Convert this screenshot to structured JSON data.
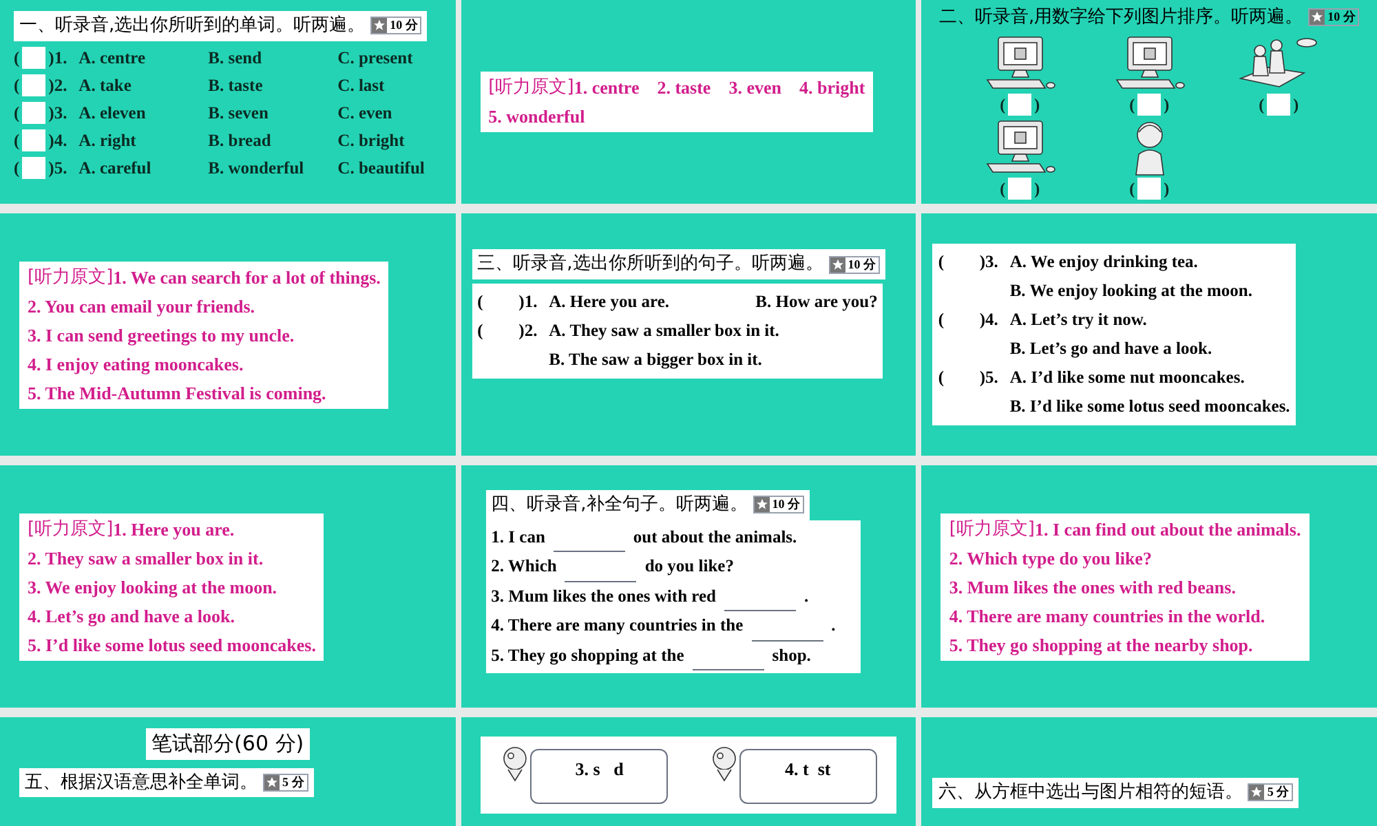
{
  "rows": [
    {
      "slides": [
        {
          "kind": "choice_words",
          "heading": {
            "text": "一、听录音,选出你所听到的单词。听两遍。",
            "score": "10 分"
          },
          "items": [
            {
              "open": "(",
              "close": ")1.",
              "options": [
                "A. centre",
                "B. send",
                "C. present"
              ]
            },
            {
              "open": "(",
              "close": ")2.",
              "options": [
                "A. take",
                "B. taste",
                "C. last"
              ]
            },
            {
              "open": "(",
              "close": ")3.",
              "options": [
                "A. eleven",
                "B. seven",
                "C. even"
              ]
            },
            {
              "open": "(",
              "close": ")4.",
              "options": [
                "A. right",
                "B. bread",
                "C. bright"
              ]
            },
            {
              "open": "(",
              "close": ")5.",
              "options": [
                "A. careful",
                "B. wonderful",
                "C. beautiful"
              ]
            }
          ]
        },
        {
          "kind": "transcript",
          "label": "[听力原文]",
          "lines": [
            "1. centre    2. taste    3. even    4. bright",
            "5. wonderful"
          ]
        },
        {
          "kind": "picture_order",
          "heading": {
            "text": "二、听录音,用数字给下列图片排序。听两遍。",
            "score": "10 分"
          },
          "pictures": [
            {
              "kind": "computer",
              "open": "(",
              "close": ")"
            },
            {
              "kind": "computer",
              "open": "(",
              "close": ")"
            },
            {
              "kind": "children",
              "open": "(",
              "close": ")"
            },
            {
              "kind": "computer",
              "open": "(",
              "close": ")"
            },
            {
              "kind": "girl",
              "open": "(",
              "close": ")"
            }
          ]
        }
      ]
    },
    {
      "slides": [
        {
          "kind": "transcript",
          "label": "[听力原文]",
          "lines": [
            "1. We can search for a lot of things.",
            "2. You can email your friends.",
            "3. I can send greetings to my uncle.",
            "4. I enjoy eating mooncakes.",
            "5. The Mid-Autumn Festival is coming."
          ]
        },
        {
          "kind": "choice_sentences",
          "heading": {
            "text": "三、听录音,选出你所听到的句子。听两遍。",
            "score": "10 分"
          },
          "items": [
            {
              "open": "(",
              "close": ")1.",
              "a": "A. Here you are.",
              "b": "B. How are you?",
              "kind": "one_line"
            },
            {
              "open": "(",
              "close": ")2.",
              "a": "A. They saw a smaller box in it.",
              "b": "B. The saw a bigger box in it.",
              "kind": "two_line"
            }
          ]
        },
        {
          "kind": "choice_sentences",
          "items": [
            {
              "open": "(",
              "close": ")3.",
              "a": "A. We enjoy drinking tea.",
              "b": "B. We enjoy looking at the moon.",
              "kind": "two_line"
            },
            {
              "open": "(",
              "close": ")4.",
              "a": "A. Let’s try it now.",
              "b": "B. Let’s go and have a look.",
              "kind": "two_line"
            },
            {
              "open": "(",
              "close": ")5.",
              "a": "A. I’d like some nut mooncakes.",
              "b": "B. I’d like some lotus seed mooncakes.",
              "kind": "two_line"
            }
          ]
        }
      ]
    },
    {
      "slides": [
        {
          "kind": "transcript",
          "label": "[听力原文]",
          "lines": [
            "1. Here you are.",
            "2. They saw a smaller box in it.",
            "3. We enjoy looking at the moon.",
            "4. Let’s go and have a look.",
            "5. I’d like some lotus seed mooncakes."
          ]
        },
        {
          "kind": "fill_blanks",
          "heading": {
            "text": "四、听录音,补全句子。听两遍。",
            "score": "10 分"
          },
          "items": [
            {
              "before": "1. I can",
              "after": "out about the animals."
            },
            {
              "before": "2. Which",
              "after": "do you like?"
            },
            {
              "before": "3. Mum likes the ones with red",
              "after": "."
            },
            {
              "before": "4. There are many countries in the",
              "after": "."
            },
            {
              "before": "5. They go shopping at the",
              "after": "shop."
            }
          ]
        },
        {
          "kind": "transcript",
          "label": "[听力原文]",
          "lines": [
            "1. I can find out about the animals.",
            "2. Which type do you like?",
            "3. Mum likes the ones with red beans.",
            "4. There are many countries in the world.",
            "5. They go shopping at the nearby shop."
          ]
        }
      ]
    },
    {
      "slides": [
        {
          "kind": "section_title",
          "title": "笔试部分(60 分)",
          "heading": {
            "text": "五、根据汉语意思补全单词。",
            "score": "5 分"
          }
        },
        {
          "kind": "spelling",
          "cards": [
            {
              "text": "3. s   d"
            },
            {
              "text": "4. t  st"
            }
          ]
        },
        {
          "kind": "heading_only",
          "heading": {
            "text": "六、从方框中选出与图片相符的短语。",
            "score": "5 分"
          }
        }
      ]
    }
  ]
}
